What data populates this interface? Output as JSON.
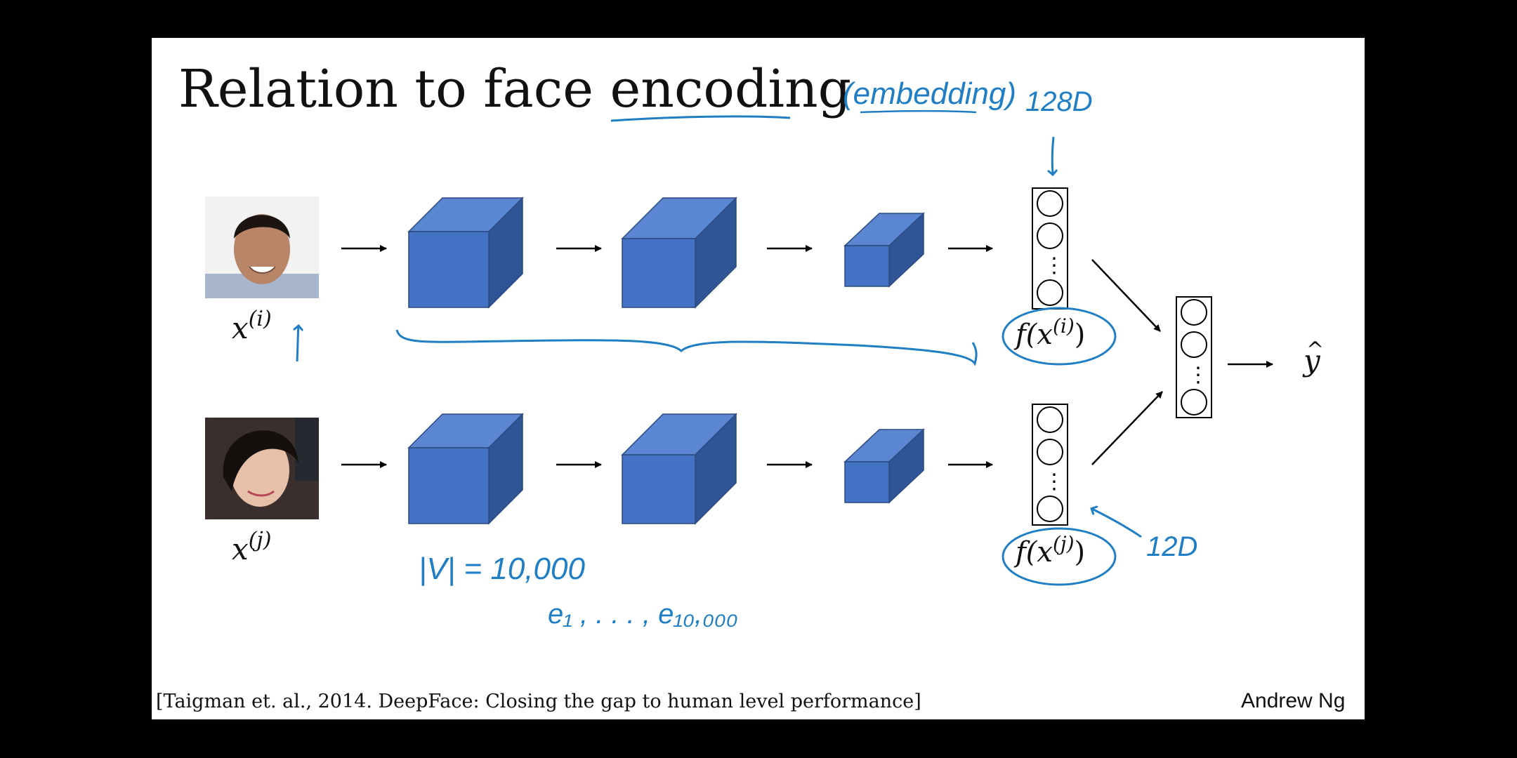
{
  "slide": {
    "title": "Relation to face encoding",
    "citation": "[Taigman et. al., 2014. DeepFace: Closing the gap to human level performance]",
    "author": "Andrew Ng"
  },
  "inputs": {
    "top_label_base": "x",
    "top_label_sup": "(i)",
    "bottom_label_base": "x",
    "bottom_label_sup": "(j)",
    "top_image": "face-photo-man",
    "bottom_image": "face-photo-woman"
  },
  "encodings": {
    "top_label": "f(x",
    "top_label_sup": "(i)",
    "bottom_label": "f(x",
    "bottom_label_sup": "(j)",
    "close_paren": ")",
    "dots": "⋮"
  },
  "output": {
    "base": "y",
    "hat": "^"
  },
  "annotations": {
    "embedding": "(embedding)",
    "dim_top": "128D",
    "dim_bottom": "12D",
    "vocab": "|V| = 10,000",
    "embeddings_list": "e₁ , . . . , e₁₀,₀₀₀"
  },
  "colors": {
    "cube_front": "#4472c4",
    "cube_top": "#5b86d1",
    "cube_side": "#2f5597",
    "cube_stroke": "#2b4a80",
    "ink_blue": "#1f7ec4",
    "arrow": "#000000"
  }
}
